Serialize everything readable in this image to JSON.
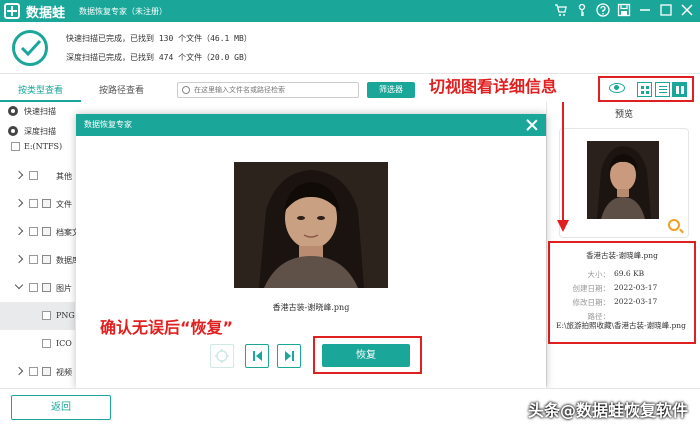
{
  "titlebar": {
    "app_name": "数据蛙",
    "subtitle": "数据恢复专家（未注册）",
    "icons": [
      "cart-icon",
      "key-icon",
      "help-icon",
      "save-icon",
      "minimize-icon",
      "maximize-icon",
      "close-icon"
    ]
  },
  "status": {
    "quick_scan": "快速扫描已完成，已找到 130 个文件（46.1 MB）",
    "deep_scan": "深度扫描已完成，已找到 474 个文件（20.0 GB）"
  },
  "tabs": [
    {
      "label": "按类型查看",
      "active": true
    },
    {
      "label": "按路径查看",
      "active": false
    }
  ],
  "search": {
    "placeholder": "在这里输入文件名或路径检索"
  },
  "filter_button": "筛选器",
  "annotations": {
    "top": "切视图看详细信息",
    "bottom": "确认无误后“恢复”"
  },
  "sidebar": {
    "scan_modes": [
      "快速扫描",
      "深度扫描"
    ],
    "tree_root": "E:(NTFS)",
    "items": [
      {
        "label": "其他"
      },
      {
        "label": "文件"
      },
      {
        "label": "档案文件"
      },
      {
        "label": "数据库"
      },
      {
        "label": "图片"
      },
      {
        "label": "PNG"
      },
      {
        "label": "ICO"
      },
      {
        "label": "视频"
      }
    ]
  },
  "preview_panel": {
    "title": "预览",
    "file_name": "香港古装-谢晓峰.png",
    "size_label": "大小：",
    "size": "69.6 KB",
    "created_label": "创建日期：",
    "created": "2022-03-17",
    "modified_label": "修改日期：",
    "modified": "2022-03-17",
    "path_label": "路径：",
    "path": "E:\\旅游拍照收藏\\香港古装-谢晓峰.png"
  },
  "dialog": {
    "title": "数据恢复专家",
    "caption": "香港古装-谢晓峰.png",
    "recover_button": "恢复"
  },
  "back_button": "返回",
  "watermark": "头条@数据蛙恢复软件",
  "colors": {
    "accent": "#1aa79a",
    "annotation": "#e02020"
  }
}
